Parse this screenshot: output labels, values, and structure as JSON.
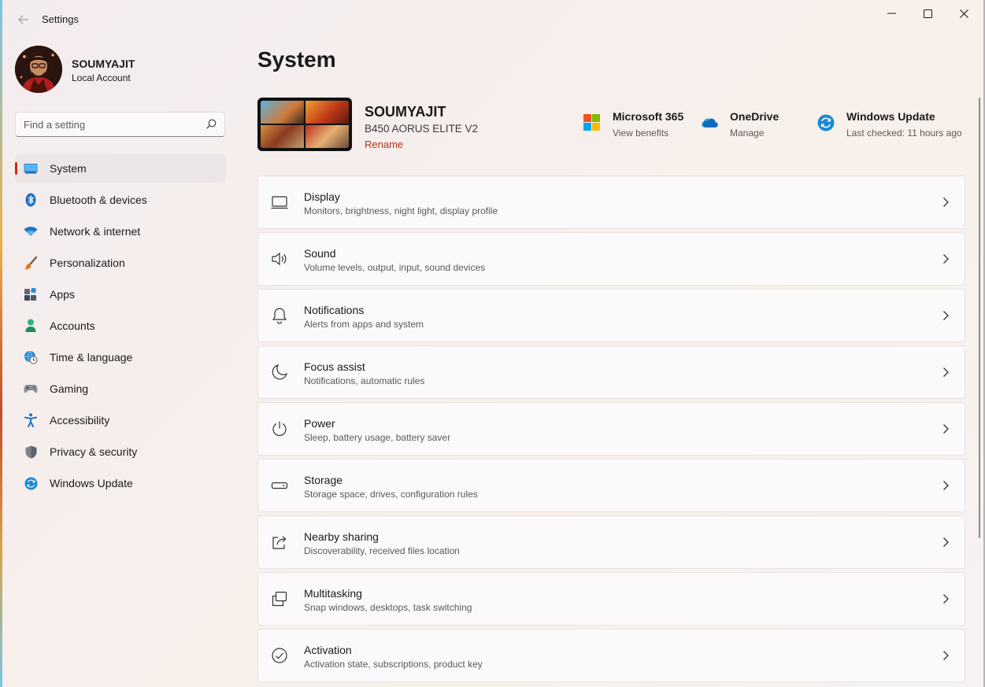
{
  "window": {
    "title": "Settings"
  },
  "profile": {
    "name": "SOUMYAJIT",
    "account_type": "Local Account"
  },
  "search": {
    "placeholder": "Find a setting"
  },
  "sidebar": {
    "items": [
      {
        "label": "System",
        "icon": "system-icon",
        "active": true
      },
      {
        "label": "Bluetooth & devices",
        "icon": "bluetooth-icon"
      },
      {
        "label": "Network & internet",
        "icon": "wifi-icon"
      },
      {
        "label": "Personalization",
        "icon": "brush-icon"
      },
      {
        "label": "Apps",
        "icon": "apps-icon"
      },
      {
        "label": "Accounts",
        "icon": "person-icon"
      },
      {
        "label": "Time & language",
        "icon": "globe-clock-icon"
      },
      {
        "label": "Gaming",
        "icon": "gamepad-icon"
      },
      {
        "label": "Accessibility",
        "icon": "accessibility-icon"
      },
      {
        "label": "Privacy & security",
        "icon": "shield-icon"
      },
      {
        "label": "Windows Update",
        "icon": "windows-update-icon"
      }
    ]
  },
  "main": {
    "page_title": "System",
    "device": {
      "name": "SOUMYAJIT",
      "model": "B450 AORUS ELITE V2",
      "rename_label": "Rename"
    },
    "quick_links": [
      {
        "title": "Microsoft 365",
        "subtitle": "View benefits",
        "icon": "microsoft-365-icon"
      },
      {
        "title": "OneDrive",
        "subtitle": "Manage",
        "icon": "onedrive-icon"
      },
      {
        "title": "Windows Update",
        "subtitle": "Last checked: 11 hours ago",
        "icon": "windows-update-icon"
      }
    ],
    "cards": [
      {
        "title": "Display",
        "subtitle": "Monitors, brightness, night light, display profile",
        "icon": "display-icon"
      },
      {
        "title": "Sound",
        "subtitle": "Volume levels, output, input, sound devices",
        "icon": "speaker-icon"
      },
      {
        "title": "Notifications",
        "subtitle": "Alerts from apps and system",
        "icon": "bell-icon"
      },
      {
        "title": "Focus assist",
        "subtitle": "Notifications, automatic rules",
        "icon": "moon-icon"
      },
      {
        "title": "Power",
        "subtitle": "Sleep, battery usage, battery saver",
        "icon": "power-icon"
      },
      {
        "title": "Storage",
        "subtitle": "Storage space, drives, configuration rules",
        "icon": "storage-icon"
      },
      {
        "title": "Nearby sharing",
        "subtitle": "Discoverability, received files location",
        "icon": "share-icon"
      },
      {
        "title": "Multitasking",
        "subtitle": "Snap windows, desktops, task switching",
        "icon": "multitasking-icon"
      },
      {
        "title": "Activation",
        "subtitle": "Activation state, subscriptions, product key",
        "icon": "activation-icon"
      }
    ]
  },
  "colors": {
    "accent": "#c42b1c",
    "rename_link": "#b4301c",
    "onedrive": "#0f6cbd",
    "update": "#1a8ad4"
  }
}
